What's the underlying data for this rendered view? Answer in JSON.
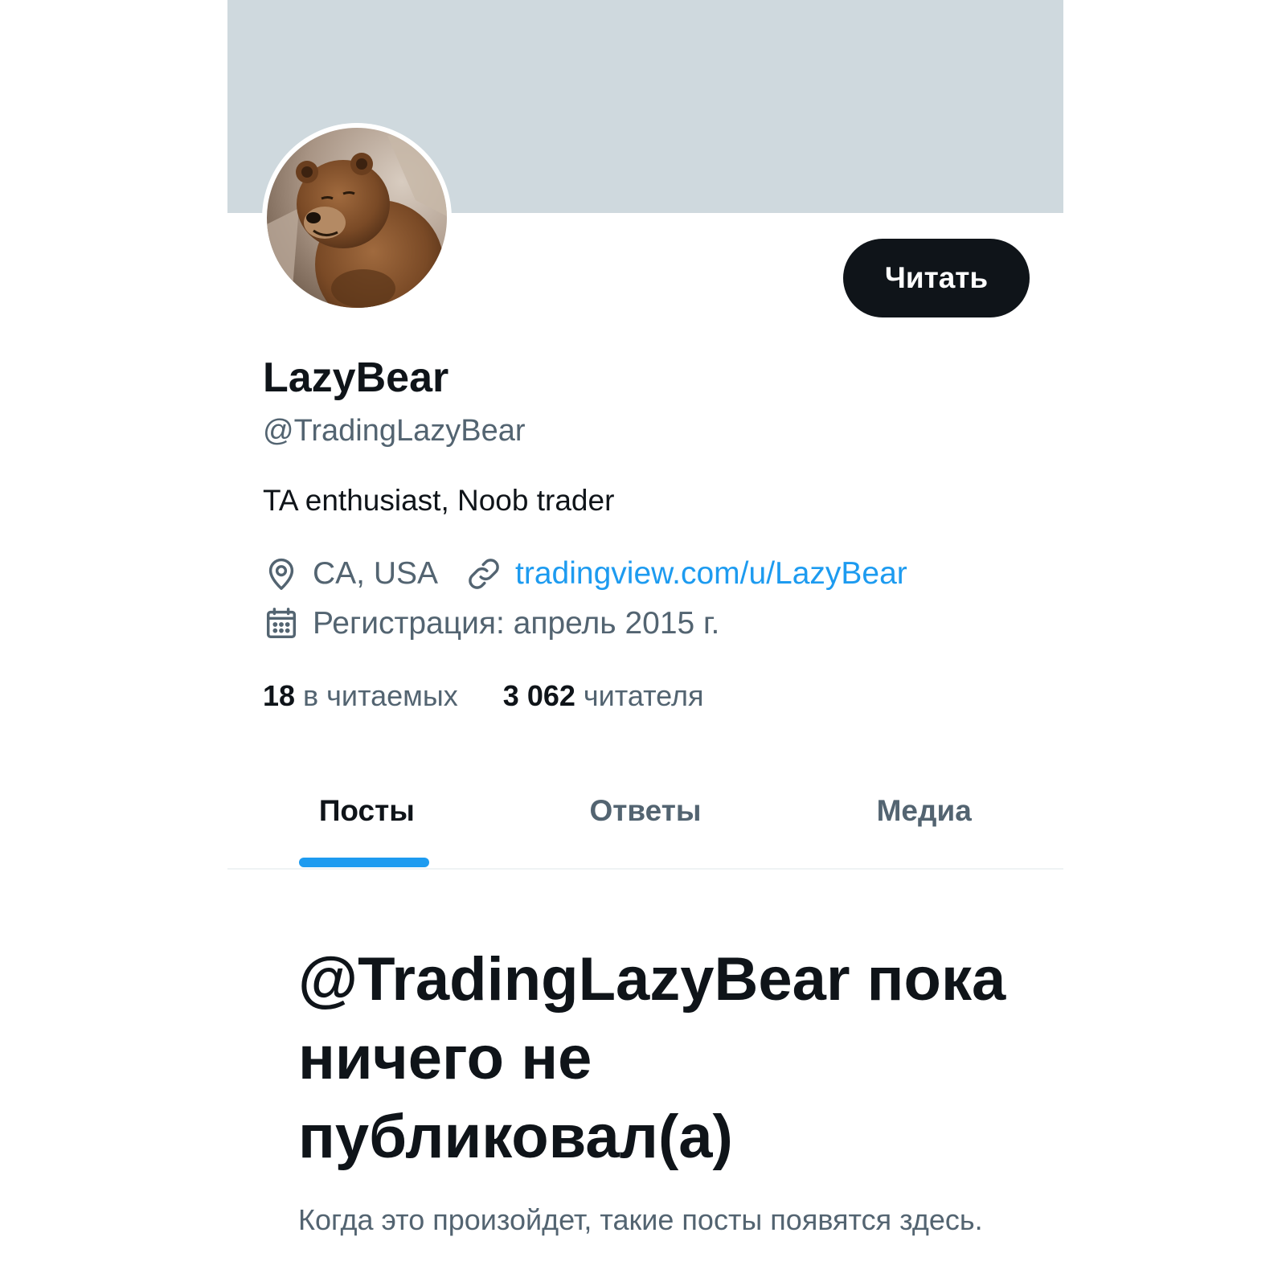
{
  "profile": {
    "display_name": "LazyBear",
    "handle": "@TradingLazyBear",
    "bio": "TA enthusiast, Noob trader",
    "location": "CA, USA",
    "website": "tradingview.com/u/LazyBear",
    "joined": "Регистрация: апрель 2015 г.",
    "follow_label": "Читать",
    "avatar_description": "avatar-photo"
  },
  "stats": {
    "following_count": "18",
    "following_label": "в читаемых",
    "followers_count": "3 062",
    "followers_label": "читателя"
  },
  "tabs": [
    {
      "label": "Посты",
      "active": true
    },
    {
      "label": "Ответы",
      "active": false
    },
    {
      "label": "Медиа",
      "active": false
    }
  ],
  "empty_state": {
    "title": "@TradingLazyBear пока ничего не публиковал(а)",
    "subtitle": "Когда это произойдет, такие посты появятся здесь."
  },
  "colors": {
    "banner": "#cfd9de",
    "accent": "#1d9bf0",
    "text_primary": "#0f1419",
    "text_secondary": "#536471"
  },
  "icons": {
    "location": "location-pin-icon",
    "link": "link-icon",
    "calendar": "calendar-icon"
  }
}
